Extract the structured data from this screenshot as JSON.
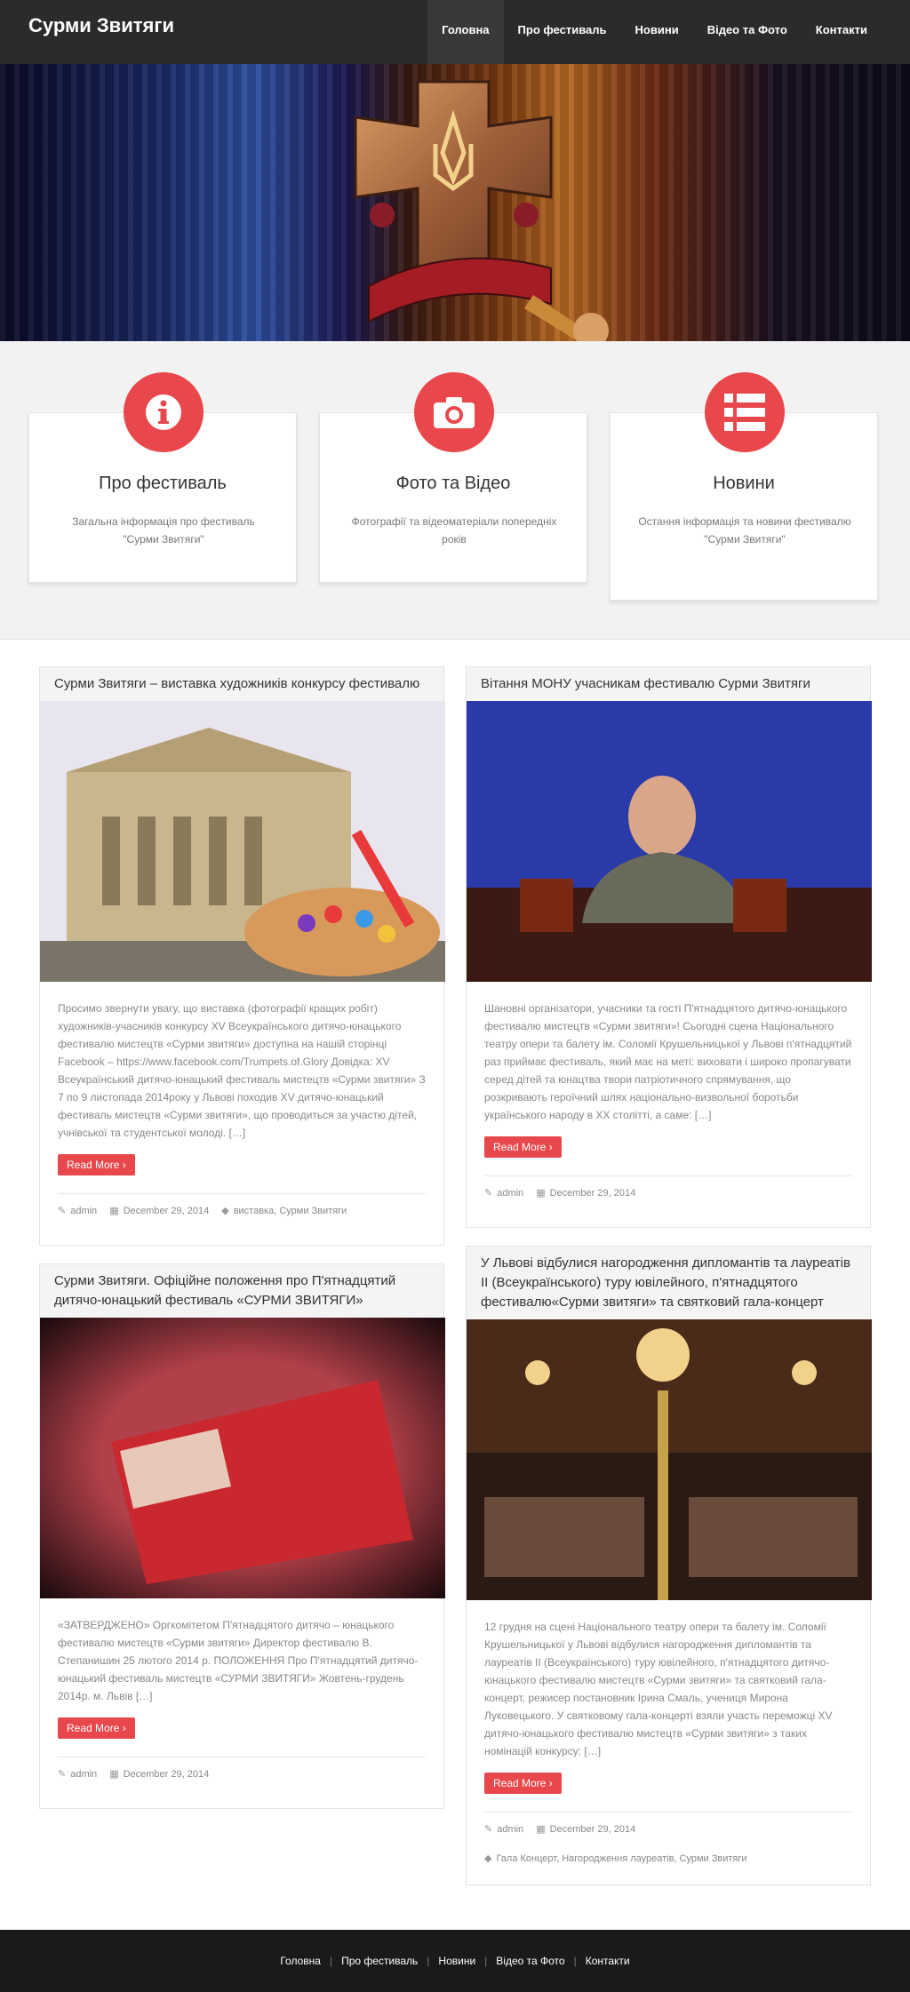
{
  "site": {
    "title": "Сурми Звитяги"
  },
  "nav": {
    "items": [
      {
        "label": "Головна"
      },
      {
        "label": "Про фестиваль"
      },
      {
        "label": "Новини"
      },
      {
        "label": "Відео та Фото"
      },
      {
        "label": "Контакти"
      }
    ]
  },
  "features": [
    {
      "icon": "info-icon",
      "title": "Про фестиваль",
      "desc": "Загальна інформація про фестиваль \"Сурми Звитяги\""
    },
    {
      "icon": "camera-icon",
      "title": "Фото та Відео",
      "desc": "Фотографії та відеоматеріали попередніх років"
    },
    {
      "icon": "list-icon",
      "title": "Новини",
      "desc": "Остання інформація та новини фестивалю \"Сурми Звитяги\""
    }
  ],
  "posts": [
    {
      "title": "Сурми Звитяги – виставка художників конкурсу фестивалю",
      "excerpt": "Просимо звернути увагу, що виставка (фотографії кращих робіт) художників-учасників конкурсу XV Всеукраїнського дитячо-юнацького фестивалю мистецтв «Сурми звитяги» доступна на нашій сторінці Facebook – https://www.facebook.com/Trumpets.of.Glory Довідка: XV Всеукраїнський дитячо-юнацький фестиваль мистецтв «Сурми звитяги» З 7 по 9 листопада 2014року у Львові походив XV дитячо-юнацький фестиваль мистецтв «Сурми звитяги», що проводиться за участю дітей, учнівської та студентської молоді. […]",
      "read_more": "Read More",
      "author": "admin",
      "date": "December 29, 2014",
      "tags": "виставка, Сурми Звитяги"
    },
    {
      "title": "Вітання МОНУ учасникам фестивалю Сурми Звитяги",
      "excerpt": "Шановні організатори, учасники та гості П'ятнадцятого дитячо-юнацького фестивалю мистецтв «Сурми звитяги»! Сьогодні сцена Національного театру опери та балету ім. Соломії Крушельницької у Львові п'ятнадцятий раз приймає фестиваль, який має на меті: виховати і широко пропагувати серед дітей та юнацтва твори патріотичного спрямування, що розкривають героїчний шлях національно-визвольної боротьби українського народу в ХХ столітті, а саме: […]",
      "read_more": "Read More",
      "author": "admin",
      "date": "December 29, 2014",
      "tags": ""
    },
    {
      "title": "Сурми Звитяги. Офіційне положення про П'ятнадцятий дитячо-юнацький фестиваль «СУРМИ ЗВИТЯГИ»",
      "excerpt": "«ЗАТВЕРДЖЕНО» Оргкомітетом П'ятнадцятого дитячо – юнацького фестивалю мистецтв «Сурми звитяги» Директор фестивалю В. Степанишин 25 лютого 2014 р. ПОЛОЖЕННЯ Про П'ятнадцятий дитячо-юнацький фестиваль мистецтв «СУРМИ ЗВИТЯГИ» Жовтень-грудень 2014р. м. Львів […]",
      "read_more": "Read More",
      "author": "admin",
      "date": "December 29, 2014",
      "tags": ""
    },
    {
      "title": "У Львові відбулися нагородження дипломантів та лауреатів ІІ (Всеукраїнського) туру ювілейного, п'ятнадцятого фестивалю«Сурми звитяги» та святковий гала-концерт",
      "excerpt": "12 грудня на сцені Національного театру опери та балету ім. Соломії Крушельницької у Львові відбулися нагородження дипломантів та лауреатів ІІ (Всеукраїнського) туру ювілейного, п'ятнадцятого дитячо-юнацького фестивалю мистецтв «Сурми звитяги» та святковий гала-концерт, режисер постановник Ірина Смаль, учениця Мирона Луковецького. У святковому гала-концерті взяли участь переможці XV дитячо-юнацького фестивалю мистецтв «Сурми звитяги» з таких номінацій конкурсу: […]",
      "read_more": "Read More",
      "author": "admin",
      "date": "December 29, 2014",
      "tags": "Гала Концерт, Нагородження лауреатів, Сурми Звитяги"
    }
  ],
  "footer": {
    "links": [
      "Головна",
      "Про фестиваль",
      "Новини",
      "Відео та Фото",
      "Контакти"
    ]
  },
  "colors": {
    "accent": "#e8474b",
    "header": "#2b2b2b",
    "footer": "#1a1a1a"
  }
}
